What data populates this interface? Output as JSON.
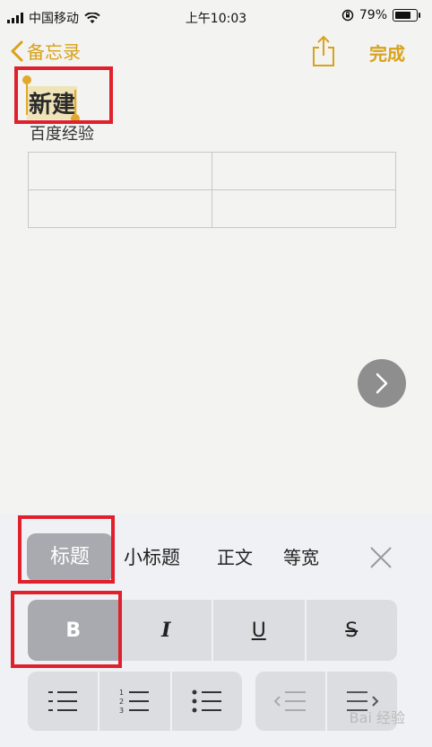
{
  "status": {
    "carrier": "中国移动",
    "time": "上午10:03",
    "battery": "79%",
    "battery_level": 0.79
  },
  "nav": {
    "back_label": "备忘录",
    "done_label": "完成"
  },
  "note": {
    "title": "新建",
    "body": "百度经验",
    "table_rows": 2,
    "table_cols": 2
  },
  "panel": {
    "styles": [
      "标题",
      "小标题",
      "正文",
      "等宽"
    ],
    "formats": [
      "B",
      "I",
      "U",
      "S"
    ]
  },
  "watermark": "Bai 经验",
  "colors": {
    "accent": "#d8a21b",
    "highlight_box": "#e0202c",
    "selected_chip": "#a9aaaf"
  }
}
